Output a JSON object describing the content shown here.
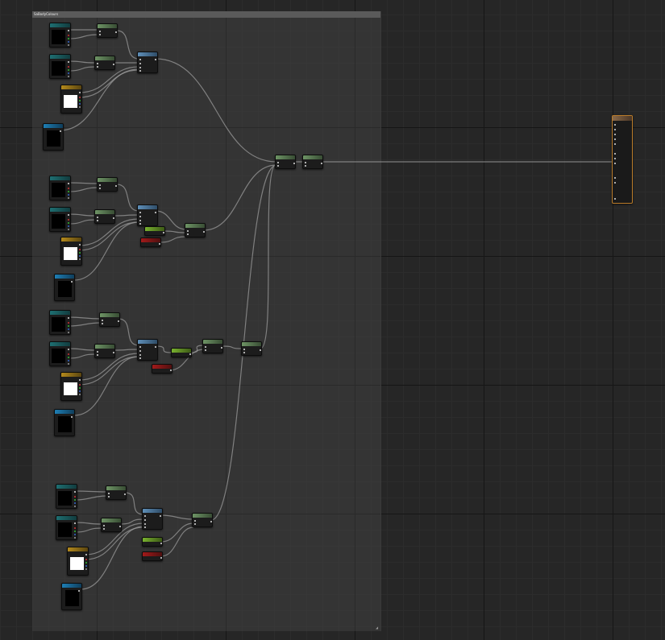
{
  "comment": {
    "title": "SaBodyColours"
  },
  "colors": {
    "texture_sample": "#1e6f72",
    "texture_yellow": "#b48a1c",
    "texture_param": "#1e7fb5",
    "math": "#6e9465",
    "function": "#5f8fb8",
    "constant_green": "#79b22f",
    "constant_red": "#a21a1a",
    "output_border": "#b97b29",
    "wire": "#9a9a9a"
  },
  "icons": {
    "comment_resize": "resize-grip-icon"
  }
}
